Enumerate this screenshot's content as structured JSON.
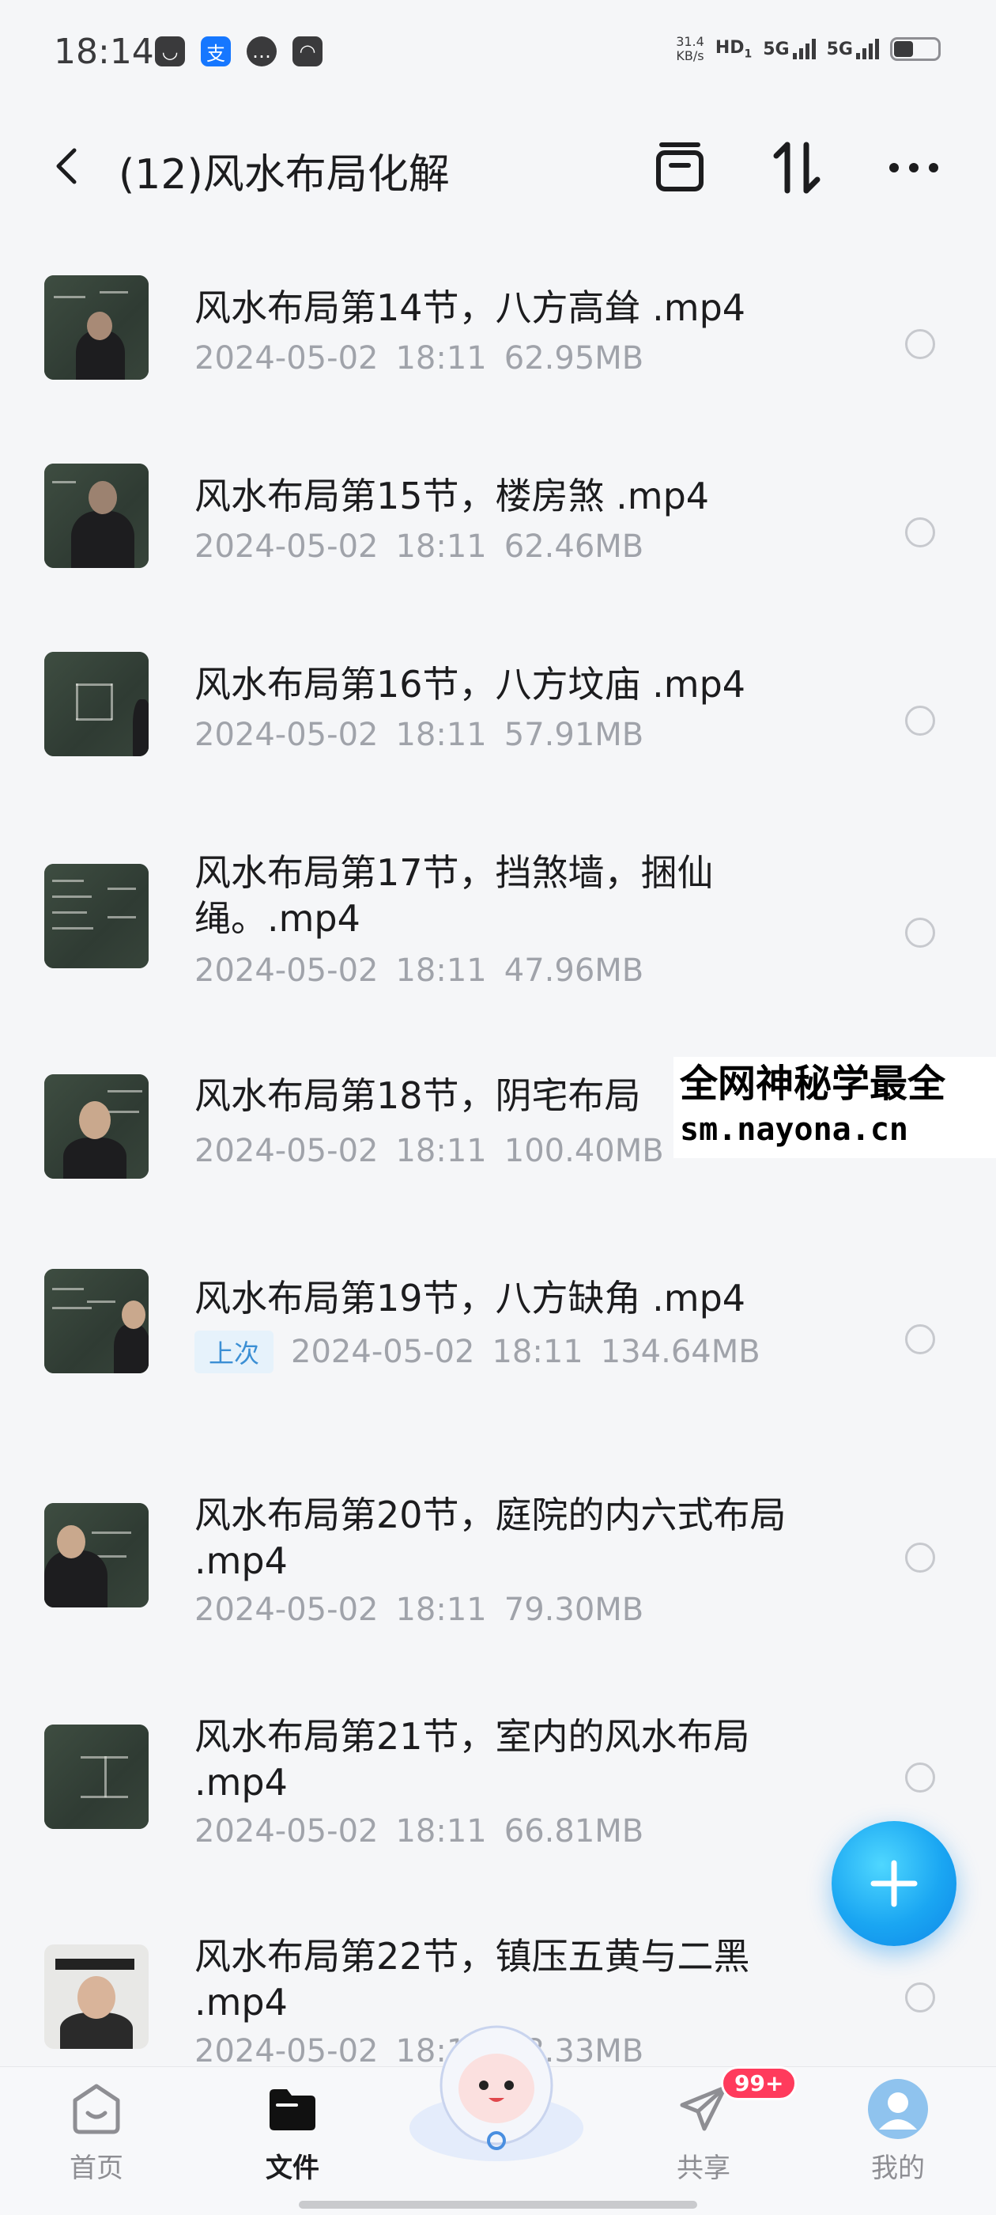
{
  "status_bar": {
    "time": "18:14",
    "net_speed_value": "31.4",
    "net_speed_unit": "KB/s",
    "hd_label": "HD",
    "sim1": "1",
    "sim2": "2",
    "signal1": "5G",
    "signal2": "5G",
    "battery_level": 0.45
  },
  "header": {
    "title": "(12)风水布局化解"
  },
  "files": [
    {
      "name": "风水布局第14节，八方高耸 .mp4",
      "date": "2024-05-02",
      "time": "18:11",
      "size": "62.95MB"
    },
    {
      "name": "风水布局第15节，楼房煞 .mp4",
      "date": "2024-05-02",
      "time": "18:11",
      "size": "62.46MB"
    },
    {
      "name": "风水布局第16节，八方坟庙 .mp4",
      "date": "2024-05-02",
      "time": "18:11",
      "size": "57.91MB"
    },
    {
      "name": "风水布局第17节，挡煞墙，捆仙绳。.mp4",
      "date": "2024-05-02",
      "time": "18:11",
      "size": "47.96MB"
    },
    {
      "name": "风水布局第18节，阴宅布局",
      "date": "2024-05-02",
      "time": "18:11",
      "size": "100.40MB"
    },
    {
      "name": "风水布局第19节，八方缺角 .mp4",
      "tag": "上次",
      "date": "2024-05-02",
      "time": "18:11",
      "size": "134.64MB"
    },
    {
      "name": "风水布局第20节，庭院的内六式布局 .mp4",
      "date": "2024-05-02",
      "time": "18:11",
      "size": "79.30MB"
    },
    {
      "name": "风水布局第21节，室内的风水布局 .mp4",
      "date": "2024-05-02",
      "time": "18:11",
      "size": "66.81MB"
    },
    {
      "name": "风水布局第22节，镇压五黄与二黑 .mp4",
      "date": "2024-05-02",
      "time": "18:11",
      "size": "28.33MB"
    }
  ],
  "watermark": {
    "line1": "全网神秘学最全",
    "line2": "sm.nayona.cn"
  },
  "bottom_nav": {
    "home": "首页",
    "files": "文件",
    "share": "共享",
    "mine": "我的",
    "share_badge": "99+"
  },
  "colors": {
    "accent": "#1aa6f2",
    "badge": "#ff3b5c",
    "meta_text": "#a0a3aa"
  }
}
